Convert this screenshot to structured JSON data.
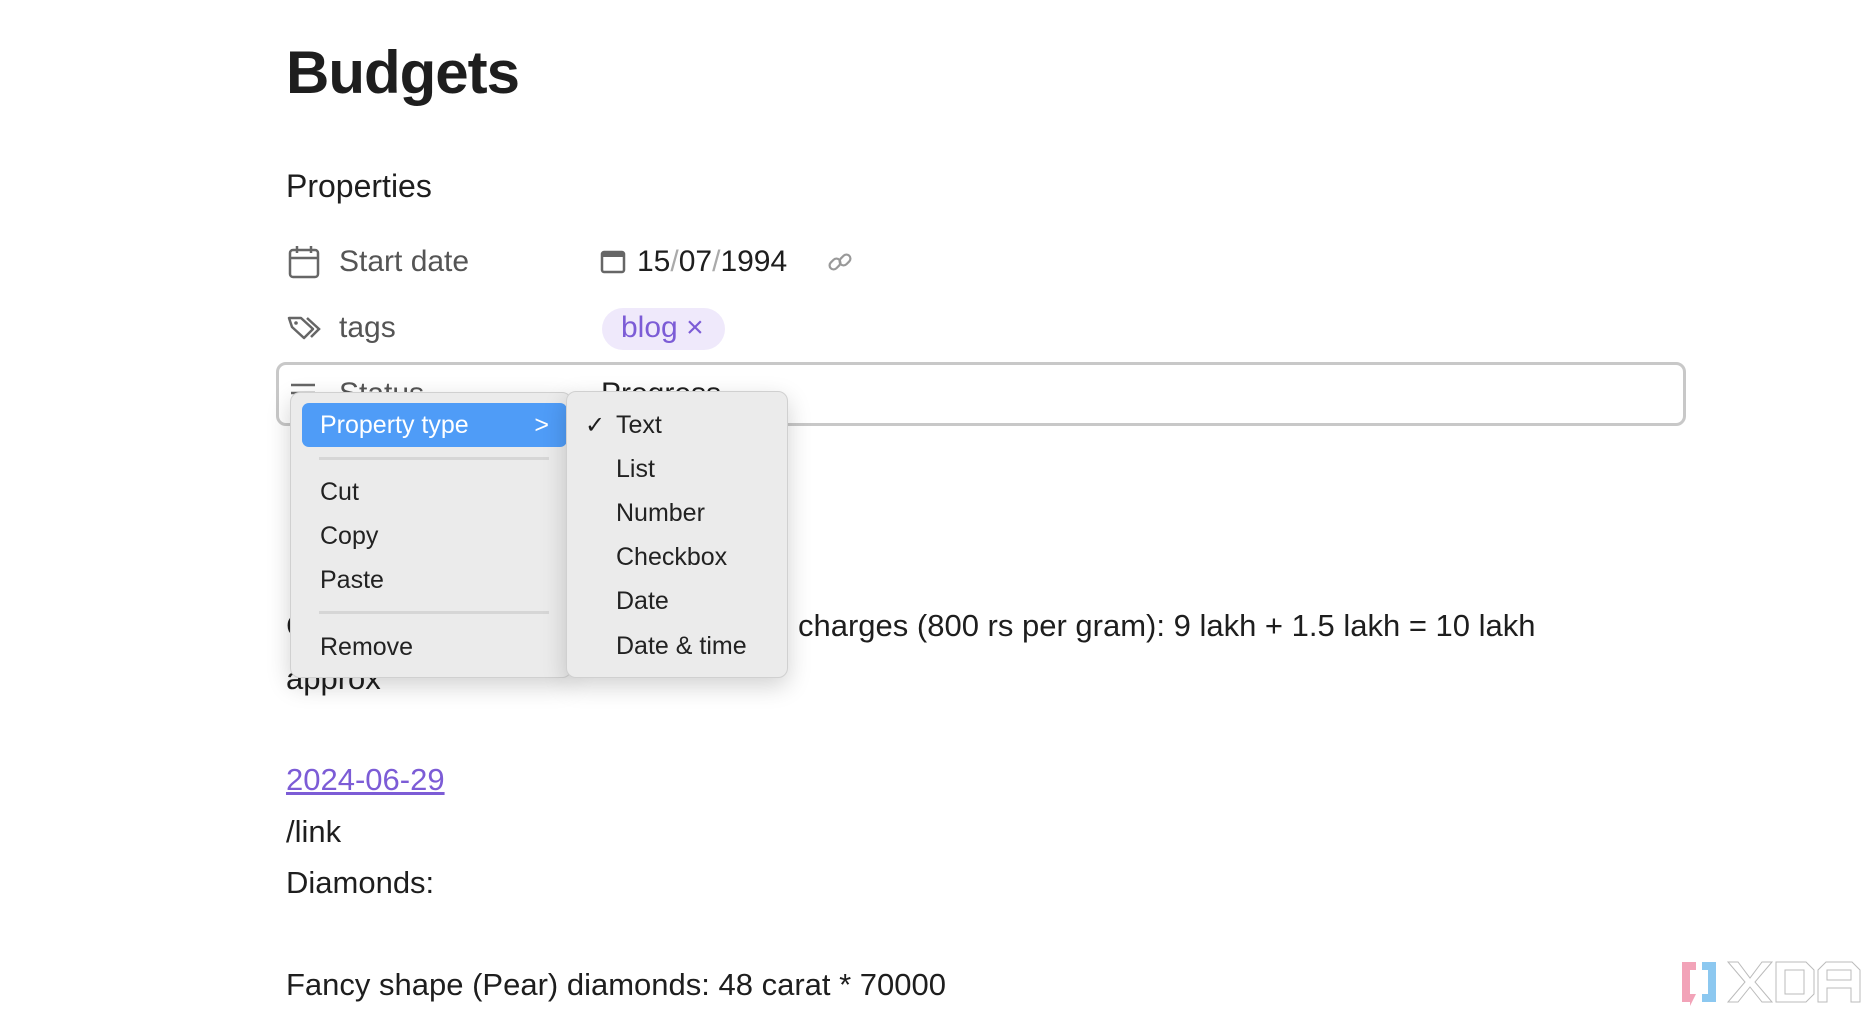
{
  "page": {
    "title": "Budgets"
  },
  "properties": {
    "heading": "Properties",
    "rows": [
      {
        "label": "Start date",
        "icon": "calendar-icon",
        "value": {
          "day": "15",
          "month": "07",
          "year": "1994",
          "sep": "/"
        }
      },
      {
        "label": "tags",
        "icon": "tags-icon",
        "chip": "blog",
        "chip_remove": "×"
      },
      {
        "label": "Status",
        "icon": "lines-icon",
        "value": "Progress"
      }
    ]
  },
  "context_menu": {
    "items": [
      {
        "label": "Property type",
        "arrow": ">"
      },
      {
        "label": "Cut"
      },
      {
        "label": "Copy"
      },
      {
        "label": "Paste"
      },
      {
        "label": "Remove"
      }
    ]
  },
  "submenu": {
    "check": "✓",
    "items": [
      {
        "label": "Text",
        "checked": true
      },
      {
        "label": "List"
      },
      {
        "label": "Number"
      },
      {
        "label": "Checkbox"
      },
      {
        "label": "Date"
      },
      {
        "label": "Date & time"
      }
    ]
  },
  "body": {
    "line1_start": "C",
    "line1_end": "charges (800 rs per gram): 9 lakh + 1.5 lakh = 10 lakh",
    "line2": "approx",
    "link": "2024-06-29",
    "line3": "/link",
    "line4": "Diamonds:",
    "line5": "Fancy shape (Pear) diamonds: 48 carat * 70000"
  },
  "watermark": {
    "text": "XDA"
  },
  "colors": {
    "accent": "#7c5cd6",
    "highlight": "#4f9cf7",
    "chip_bg": "#efe9fb"
  }
}
